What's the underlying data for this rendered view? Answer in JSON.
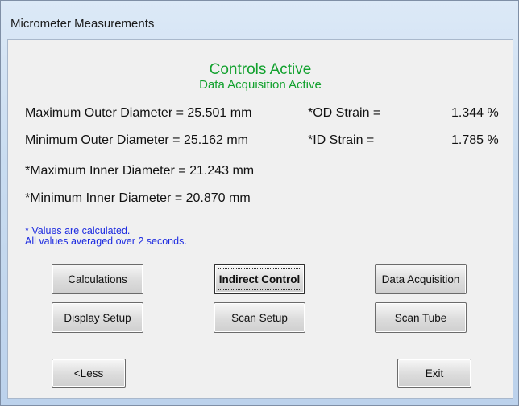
{
  "window": {
    "title": "Micrometer Measurements"
  },
  "status": {
    "controls": "Controls Active",
    "acquisition": "Data Acquisition Active"
  },
  "measurements": {
    "max_od": "Maximum Outer Diameter = 25.501  mm",
    "min_od": "Minimum Outer Diameter =  25.162  mm",
    "max_id": "*Maximum Inner Diameter = 21.243  mm",
    "min_id": "*Minimum Inner Diameter =  20.870  mm",
    "od_strain_label": "*OD Strain =",
    "od_strain_value": "1.344  %",
    "id_strain_label": "*ID Strain =",
    "id_strain_value": "1.785  %"
  },
  "notes": {
    "line1": "* Values are calculated.",
    "line2": "All values averaged over 2 seconds."
  },
  "buttons": {
    "calculations": "Calculations",
    "indirect_control": "Indirect Control",
    "data_acquisition": "Data Acquisition",
    "display_setup": "Display Setup",
    "scan_setup": "Scan Setup",
    "scan_tube": "Scan Tube",
    "less": "<Less",
    "exit": "Exit"
  }
}
